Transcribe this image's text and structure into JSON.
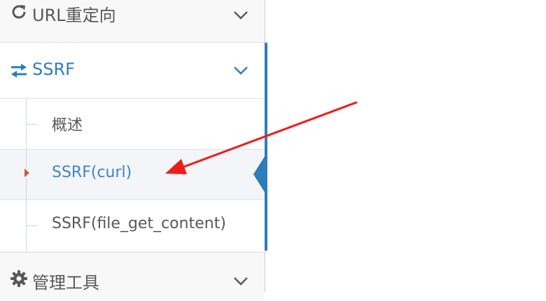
{
  "sidebar": {
    "top_item": {
      "label": "URL重定向",
      "icon": "refresh-icon"
    },
    "ssrf_item": {
      "label": "SSRF",
      "icon": "exchange-arrows-icon",
      "expanded": true
    },
    "ssrf_children": [
      {
        "label": "概述"
      },
      {
        "label": "SSRF(curl)",
        "selected": true
      },
      {
        "label": "SSRF(file_get_content)"
      }
    ],
    "bottom_item": {
      "label": "管理工具",
      "icon": "gear-icon"
    }
  },
  "colors": {
    "accent": "#2b7dbc",
    "active_text": "#4183c4",
    "annotation_arrow": "#ee1c1c",
    "caret": "#c75b3a"
  }
}
